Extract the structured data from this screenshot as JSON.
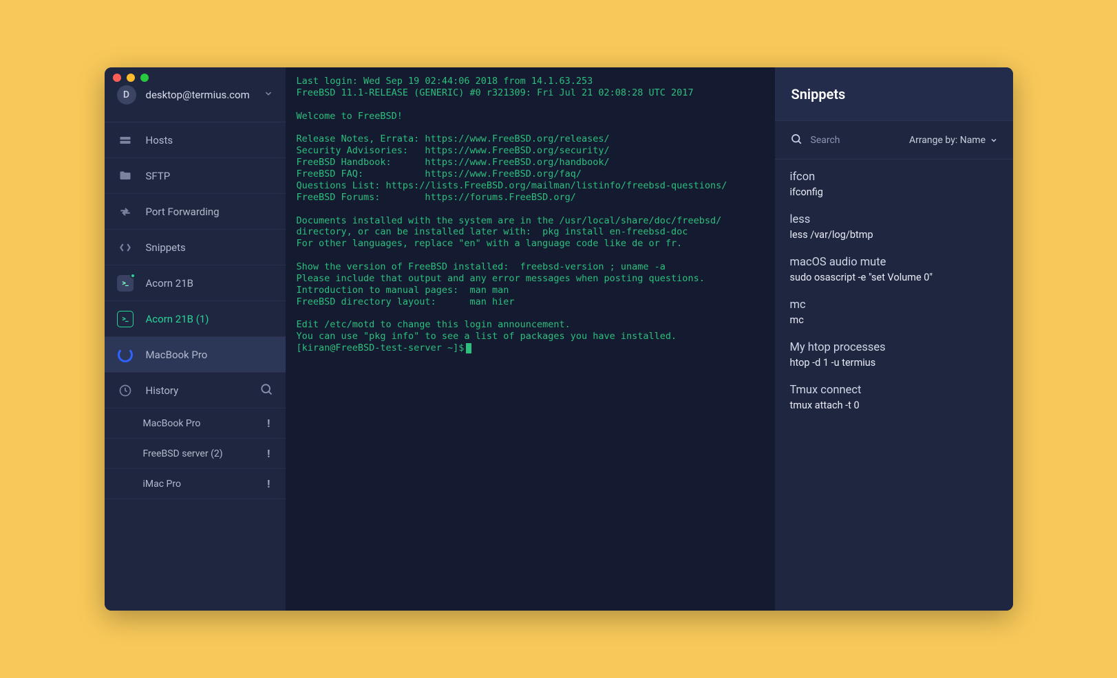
{
  "account": {
    "avatar_letter": "D",
    "email": "desktop@termius.com"
  },
  "sidebar": {
    "items": [
      {
        "label": "Hosts"
      },
      {
        "label": "SFTP"
      },
      {
        "label": "Port Forwarding"
      },
      {
        "label": "Snippets"
      },
      {
        "label": "Acorn 21B"
      },
      {
        "label": "Acorn 21B (1)"
      },
      {
        "label": "MacBook Pro"
      }
    ],
    "history_label": "History",
    "history": [
      {
        "label": "MacBook Pro"
      },
      {
        "label": "FreeBSD server (2)"
      },
      {
        "label": "iMac Pro"
      }
    ]
  },
  "terminal": {
    "lines": [
      "Last login: Wed Sep 19 02:44:06 2018 from 14.1.63.253",
      "FreeBSD 11.1-RELEASE (GENERIC) #0 r321309: Fri Jul 21 02:08:28 UTC 2017",
      "",
      "Welcome to FreeBSD!",
      "",
      "Release Notes, Errata: https://www.FreeBSD.org/releases/",
      "Security Advisories:   https://www.FreeBSD.org/security/",
      "FreeBSD Handbook:      https://www.FreeBSD.org/handbook/",
      "FreeBSD FAQ:           https://www.FreeBSD.org/faq/",
      "Questions List: https://lists.FreeBSD.org/mailman/listinfo/freebsd-questions/",
      "FreeBSD Forums:        https://forums.FreeBSD.org/",
      "",
      "Documents installed with the system are in the /usr/local/share/doc/freebsd/",
      "directory, or can be installed later with:  pkg install en-freebsd-doc",
      "For other languages, replace \"en\" with a language code like de or fr.",
      "",
      "Show the version of FreeBSD installed:  freebsd-version ; uname -a",
      "Please include that output and any error messages when posting questions.",
      "Introduction to manual pages:  man man",
      "FreeBSD directory layout:      man hier",
      "",
      "Edit /etc/motd to change this login announcement.",
      "You can use \"pkg info\" to see a list of packages you have installed."
    ],
    "prompt": "[kiran@FreeBSD-test-server ~]$"
  },
  "snippets": {
    "title": "Snippets",
    "search_placeholder": "Search",
    "arrange_label": "Arrange by:",
    "arrange_value": "Name",
    "items": [
      {
        "title": "ifcon",
        "cmd": "ifconfig"
      },
      {
        "title": "less",
        "cmd": "less /var/log/btmp"
      },
      {
        "title": "macOS audio mute",
        "cmd": "sudo osascript -e \"set Volume 0\""
      },
      {
        "title": "mc",
        "cmd": "mc"
      },
      {
        "title": "My htop processes",
        "cmd": "htop -d 1 -u termius"
      },
      {
        "title": "Tmux connect",
        "cmd": "tmux attach -t 0"
      }
    ]
  }
}
